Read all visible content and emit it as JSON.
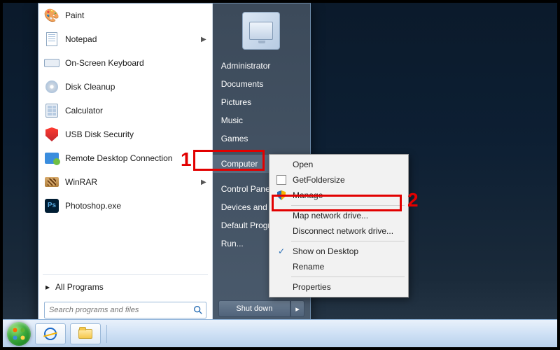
{
  "start_menu": {
    "programs": [
      {
        "label": "Paint",
        "icon": "brush",
        "submenu": false
      },
      {
        "label": "Notepad",
        "icon": "note",
        "submenu": true
      },
      {
        "label": "On-Screen Keyboard",
        "icon": "kb",
        "submenu": false
      },
      {
        "label": "Disk Cleanup",
        "icon": "disk",
        "submenu": false
      },
      {
        "label": "Calculator",
        "icon": "calc",
        "submenu": false
      },
      {
        "label": "USB Disk Security",
        "icon": "shield",
        "submenu": false
      },
      {
        "label": "Remote Desktop Connection",
        "icon": "rdp",
        "submenu": false
      },
      {
        "label": "WinRAR",
        "icon": "winrar",
        "submenu": true
      },
      {
        "label": "Photoshop.exe",
        "icon": "ps",
        "submenu": false
      }
    ],
    "all_programs": "All Programs",
    "search_placeholder": "Search programs and files"
  },
  "right_panel": {
    "items_top": [
      "Administrator",
      "Documents",
      "Pictures",
      "Music",
      "Games"
    ],
    "highlighted": "Computer",
    "items_bottom": [
      "Control Panel",
      "Devices and Printers",
      "Default Programs",
      "Run..."
    ],
    "shutdown": "Shut down"
  },
  "context_menu": {
    "items": [
      {
        "label": "Open",
        "icon": null
      },
      {
        "label": "GetFoldersize",
        "icon": "app"
      },
      {
        "label": "Manage",
        "icon": "shield"
      },
      {
        "label": "Map network drive...",
        "icon": null
      },
      {
        "label": "Disconnect network drive...",
        "icon": null
      },
      {
        "label": "Show on Desktop",
        "icon": "check"
      },
      {
        "label": "Rename",
        "icon": null
      },
      {
        "label": "Properties",
        "icon": null
      }
    ]
  },
  "annotations": {
    "1": "1",
    "2": "2"
  }
}
